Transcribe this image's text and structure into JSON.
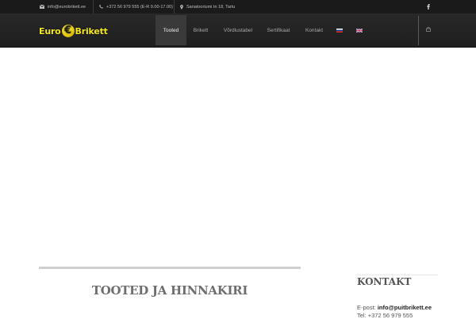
{
  "topbar": {
    "email": "info@eurobrikett.ee",
    "phone": "+372 56 979 555 (E-R 9.00-17.00)",
    "address": "Sanatooriumi tn 18, Tartu",
    "social": "facebook-icon"
  },
  "logo": {
    "part1": "Euro",
    "symbol": "€",
    "part2": "Brikett"
  },
  "nav": {
    "items": [
      {
        "label": "Tooted",
        "active": true
      },
      {
        "label": "Brikett",
        "active": false
      },
      {
        "label": "Võrdlustabel",
        "active": false
      },
      {
        "label": "Sertifikaat",
        "active": false
      },
      {
        "label": "Kontakt",
        "active": false
      }
    ],
    "languages": [
      "russian-flag-icon",
      "english-flag-icon"
    ],
    "cart": "shopping-bag-icon"
  },
  "main": {
    "heading": "TOOTED JA HINNAKIRI"
  },
  "sidebar": {
    "heading": "KONTAKT",
    "email_label": "E-post: ",
    "email": "info@puitbrikett.ee",
    "phone": "Tel: +372 56 979 555"
  },
  "colors": {
    "topbar": "#1a1a1a",
    "navbar": "#242424",
    "logo": "#f2e61c",
    "active_tab": "#3a3a3a"
  }
}
